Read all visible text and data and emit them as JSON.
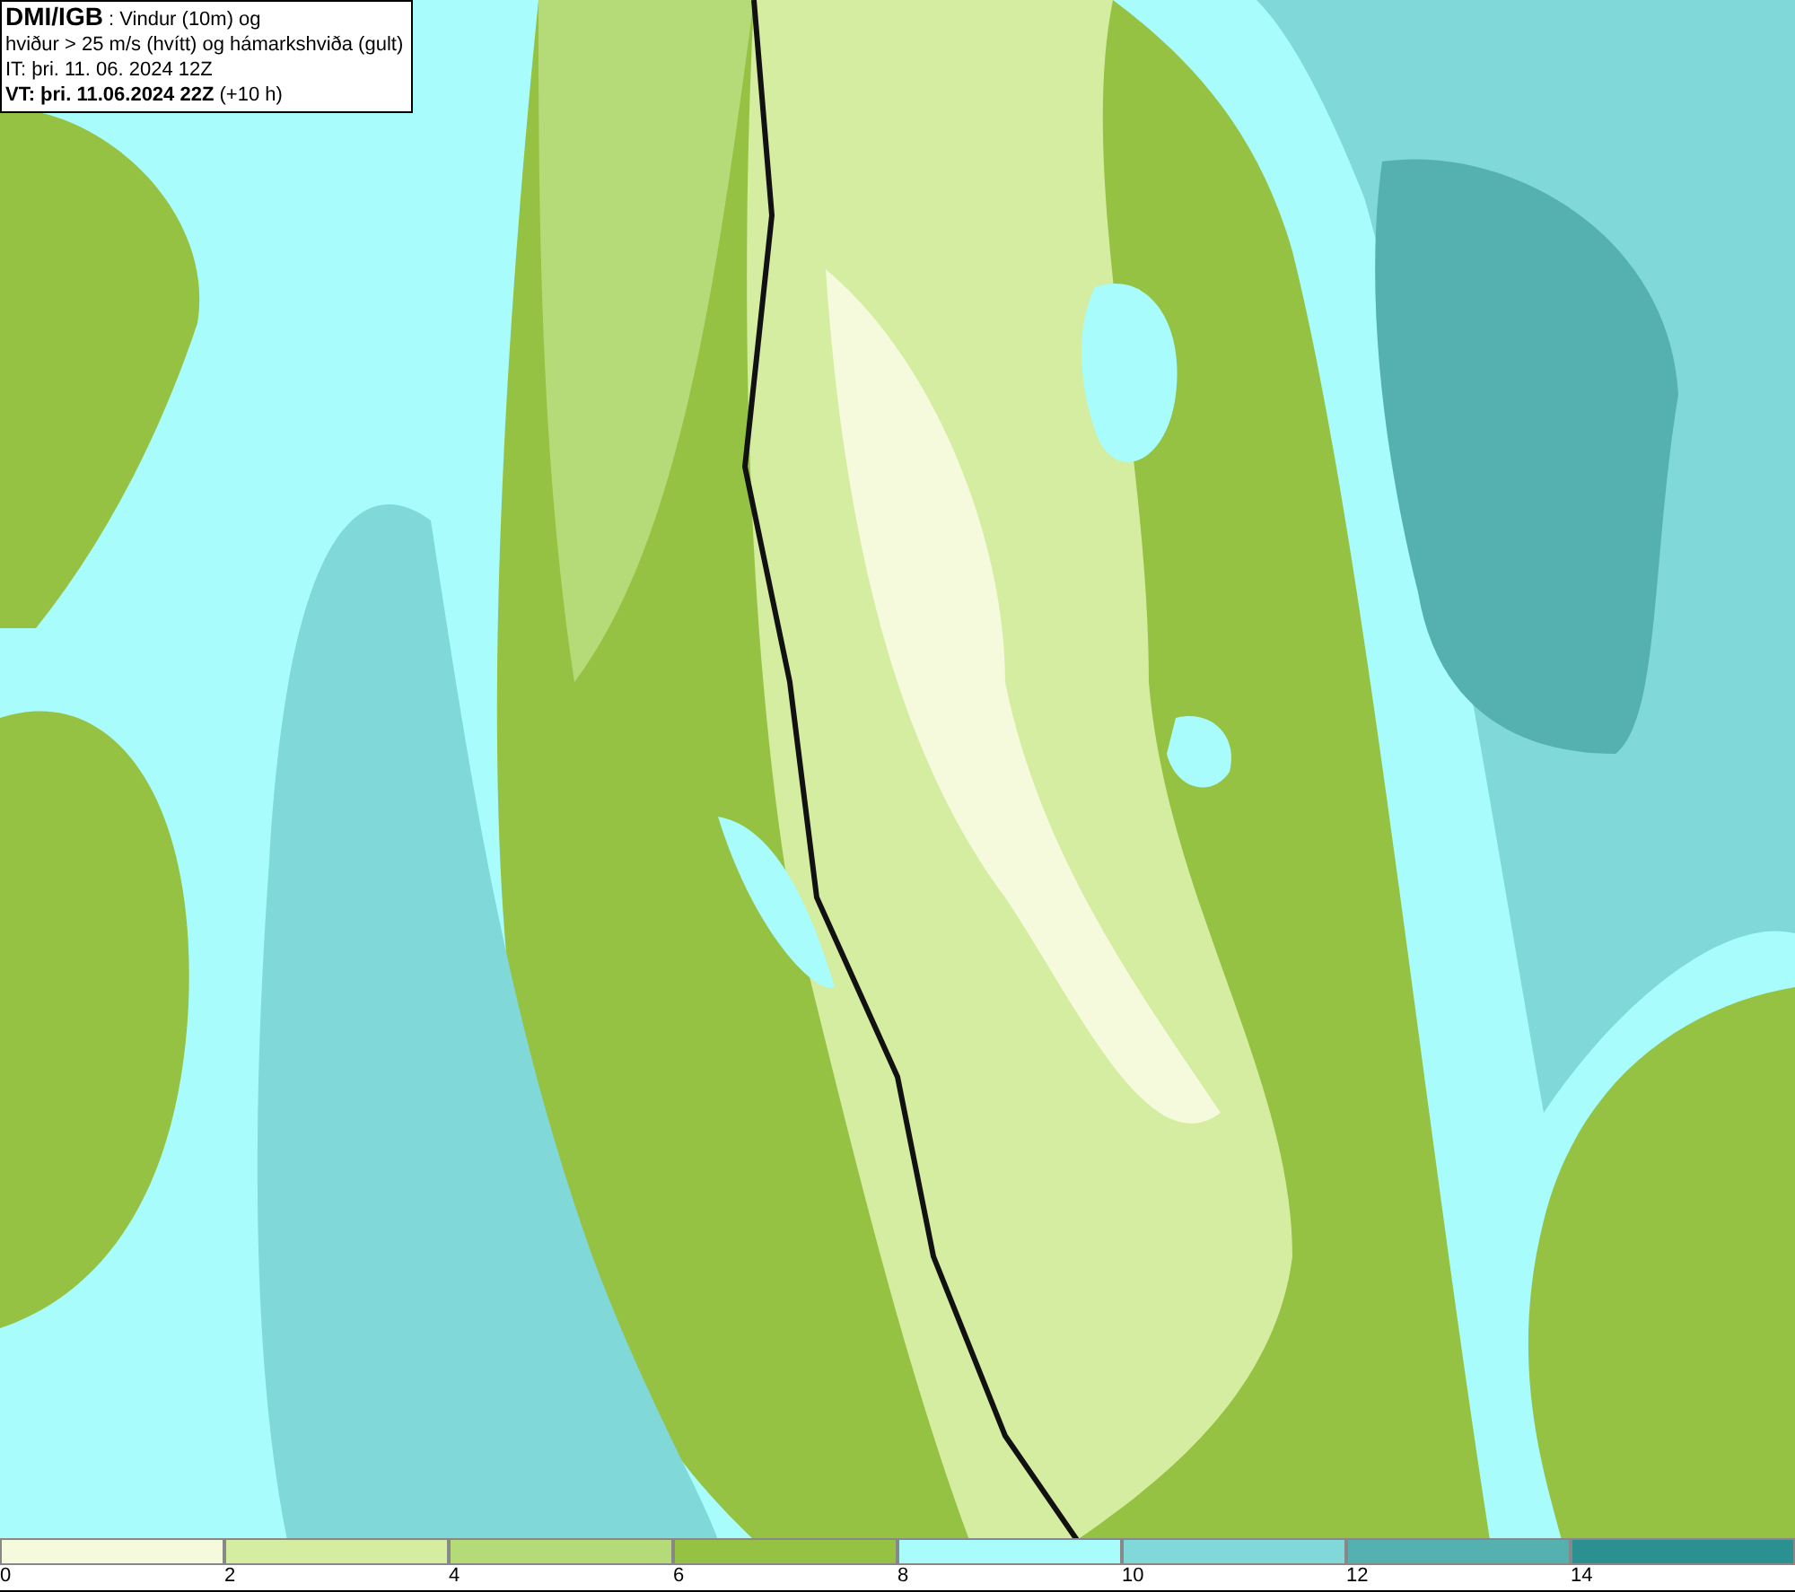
{
  "info_box": {
    "lines": [
      "**DMI/IGB** : Vindur (10m) og",
      "hviður > 25 m/s (hvítt) og hámarkshviða (gult)",
      "IT: þri. 11. 06. 2024 12Z",
      "**VT: þri. 11.06.2024 22Z** (+10 h)"
    ]
  },
  "legend": {
    "items": [
      {
        "label": "0",
        "color": "#f5fadc"
      },
      {
        "label": "2",
        "color": "#d4eda0"
      },
      {
        "label": "4",
        "color": "#b5db78"
      },
      {
        "label": "6",
        "color": "#96c244"
      },
      {
        "label": "8",
        "color": "#a8fcfc"
      },
      {
        "label": "10",
        "color": "#80d8d8"
      },
      {
        "label": "12",
        "color": "#55b0b0"
      },
      {
        "label": "14",
        "color": "#2b9090"
      }
    ]
  }
}
